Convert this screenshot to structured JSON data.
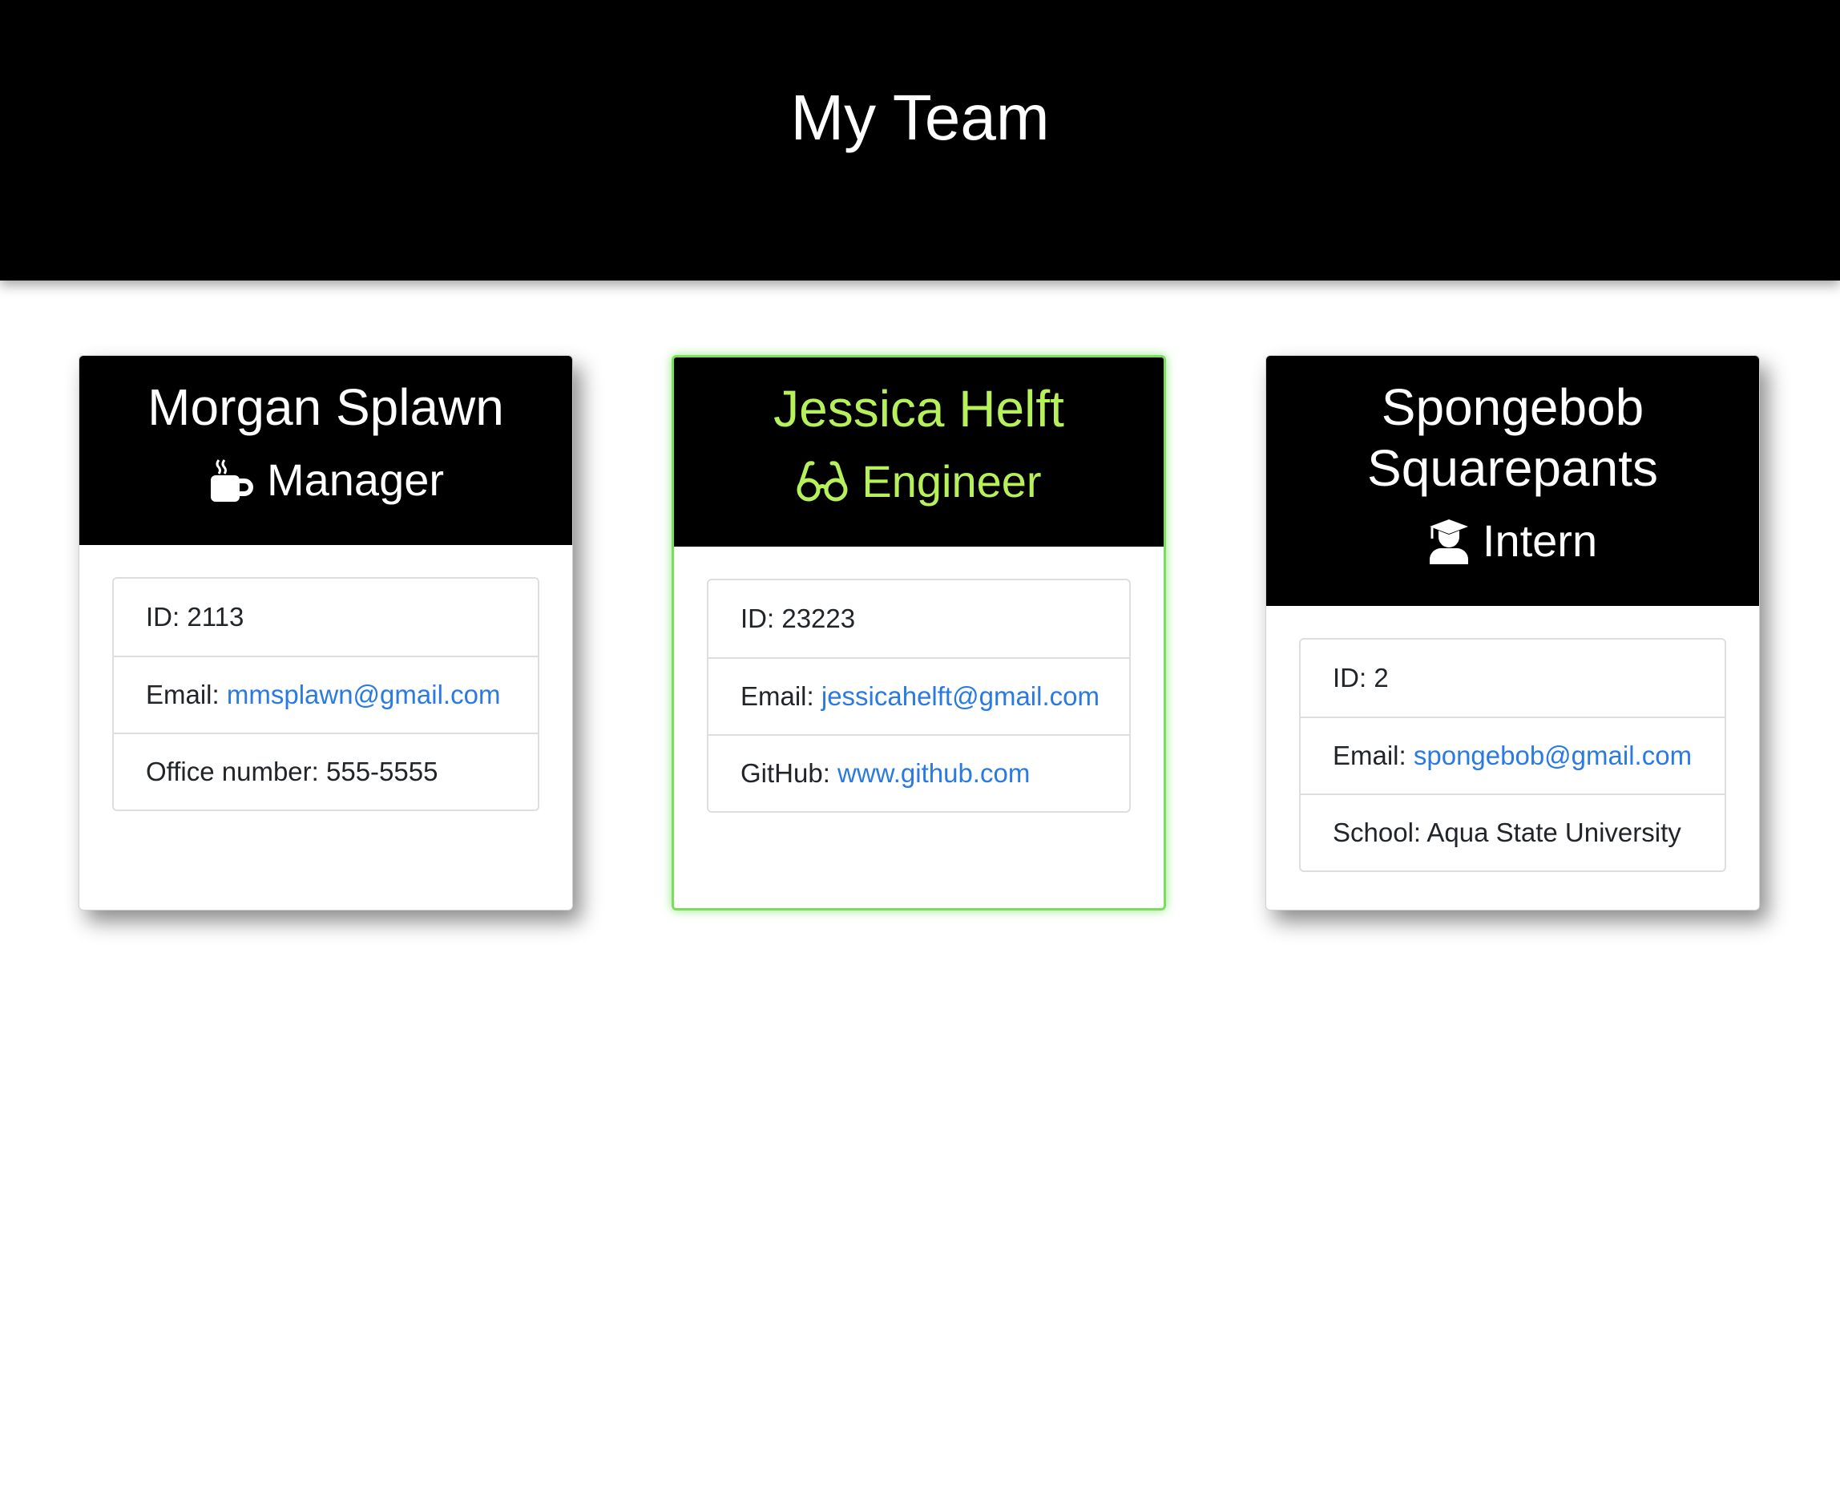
{
  "header": {
    "title": "My Team"
  },
  "colors": {
    "accent": "#b6f05a",
    "link": "#2a7ae2",
    "highlight_border": "#7cdd5c"
  },
  "cards": [
    {
      "name": "Morgan Splawn",
      "role": "Manager",
      "role_icon": "coffee-mug-icon",
      "id_label": "ID: 2113",
      "email_label": "Email: ",
      "email": "mmsplawn@gmail.com",
      "extra_label": "Office number: 555-5555"
    },
    {
      "name": "Jessica Helft",
      "role": "Engineer",
      "role_icon": "glasses-icon",
      "id_label": "ID: 23223",
      "email_label": "Email: ",
      "email": "jessicahelft@gmail.com",
      "extra_label": "GitHub: ",
      "extra_link": "www.github.com"
    },
    {
      "name": "Spongebob Squarepants",
      "role": "Intern",
      "role_icon": "graduate-icon",
      "id_label": "ID: 2",
      "email_label": "Email: ",
      "email": "spongebob@gmail.com",
      "extra_label": "School: Aqua State University"
    }
  ]
}
